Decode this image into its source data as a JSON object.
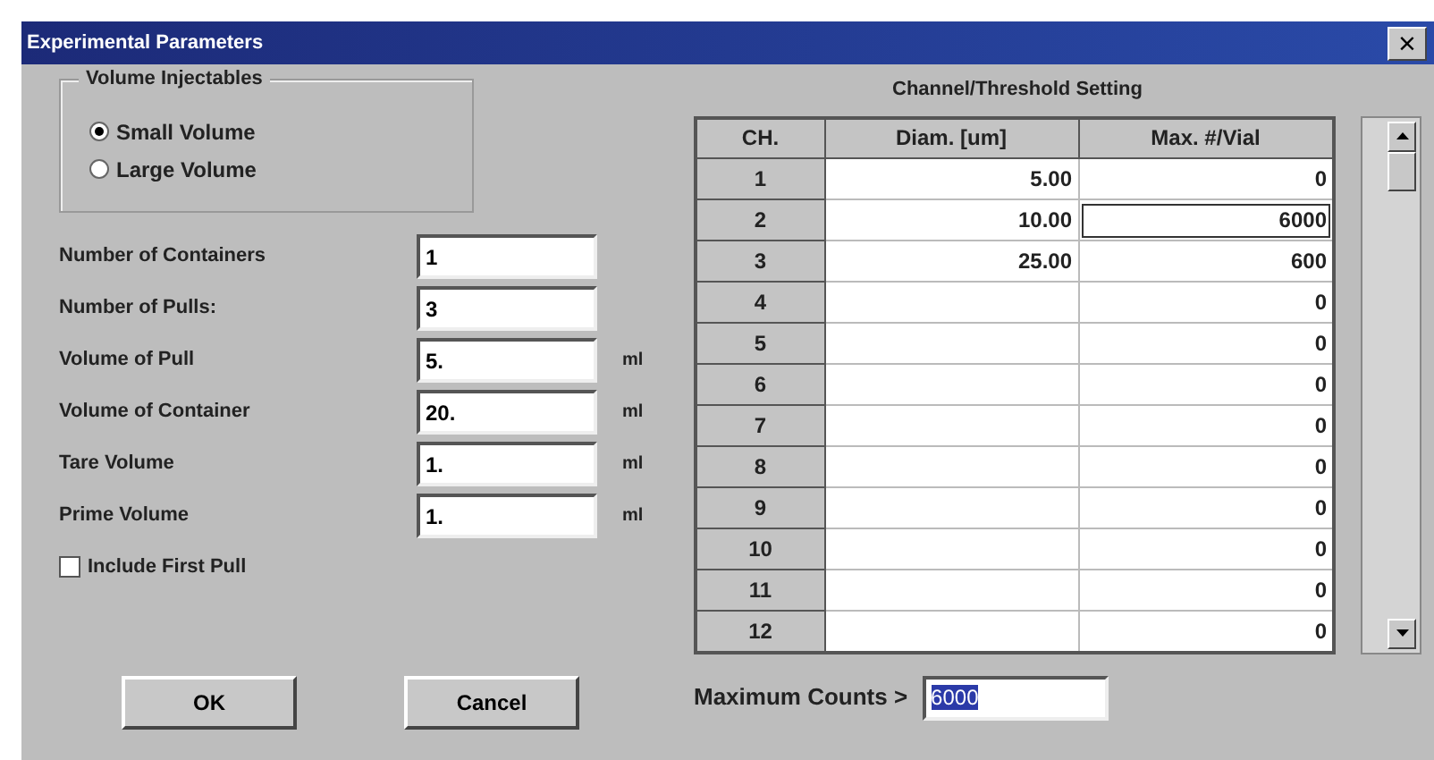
{
  "window": {
    "title": "Experimental Parameters",
    "close": "×"
  },
  "volume_group": {
    "title": "Volume Injectables",
    "options": [
      {
        "label": "Small Volume",
        "selected": true
      },
      {
        "label": "Large Volume",
        "selected": false
      }
    ]
  },
  "fields": [
    {
      "label": "Number of Containers",
      "value": "1"
    },
    {
      "label": "Number of Pulls:",
      "value": "3"
    },
    {
      "label": "Volume of Pull",
      "value": "5.",
      "unit": "ml"
    },
    {
      "label": "Volume of Container",
      "value": "20.",
      "unit": "ml"
    },
    {
      "label": "Tare Volume",
      "value": "1.",
      "unit": "ml"
    },
    {
      "label": "Prime Volume",
      "value": "1.",
      "unit": "ml"
    }
  ],
  "include_first_pull": {
    "label": "Include First Pull",
    "checked": false
  },
  "buttons": [
    "OK",
    "Cancel"
  ],
  "table": {
    "title": "Channel/Threshold Setting",
    "columns": [
      "CH.",
      "Diam. [um]",
      "Max. #/Vial"
    ],
    "rows": [
      {
        "ch": "1",
        "diam": "5.00",
        "max": "0",
        "focused": false
      },
      {
        "ch": "2",
        "diam": "10.00",
        "max": "6000",
        "focused": true
      },
      {
        "ch": "3",
        "diam": "25.00",
        "max": "600",
        "focused": false
      },
      {
        "ch": "4",
        "max": "0",
        "focused": false
      },
      {
        "ch": "5",
        "max": "0",
        "focused": false
      },
      {
        "ch": "6",
        "max": "0",
        "focused": false
      },
      {
        "ch": "7",
        "max": "0",
        "focused": false
      },
      {
        "ch": "8",
        "max": "0",
        "focused": false
      },
      {
        "ch": "9",
        "max": "0",
        "focused": false
      },
      {
        "ch": "10",
        "max": "0",
        "focused": false
      },
      {
        "ch": "11",
        "max": "0",
        "focused": false
      },
      {
        "ch": "12",
        "max": "0",
        "focused": false
      }
    ]
  },
  "maximum_counts": {
    "label": "Maximum Counts >",
    "value": "6000",
    "highlighted": true
  }
}
